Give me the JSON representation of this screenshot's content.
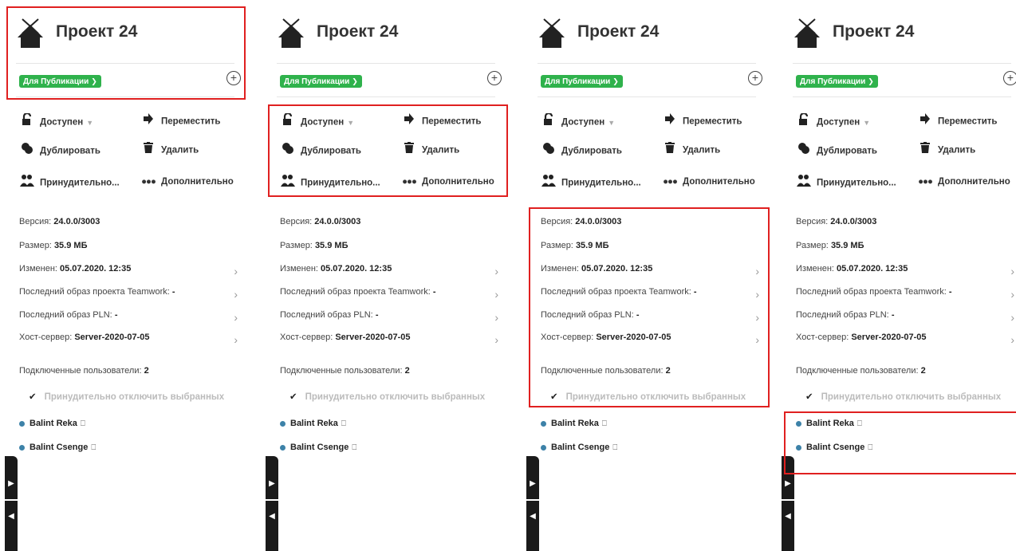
{
  "project": {
    "title": "Проект 24",
    "tag": "Для Публикации",
    "actions": {
      "available": "Доступен",
      "move": "Переместить",
      "duplicate": "Дублировать",
      "delete": "Удалить",
      "force": "Принудительно...",
      "more": "Дополнительно"
    },
    "info": {
      "version_label": "Версия:",
      "version_value": "24.0.0/3003",
      "size_label": "Размер:",
      "size_value": "35.9 МБ",
      "modified_label": "Изменен:",
      "modified_value": "05.07.2020. 12:35",
      "teamwork_label": "Последний образ проекта Teamwork:",
      "teamwork_value": "-",
      "pln_label": "Последний образ PLN:",
      "pln_value": "-",
      "host_label": "Хост-сервер:",
      "host_value": "Server-2020-07-05"
    },
    "users_label": "Подключенные пользователи:",
    "users_count": "2",
    "force_disconnect": "Принудительно отключить выбранных",
    "users": [
      "Balint Reka",
      "Balint Csenge"
    ],
    "colors": {
      "tag": "#2fb24c",
      "user_dot": "#3d82a8",
      "highlight": "#e02020"
    }
  }
}
